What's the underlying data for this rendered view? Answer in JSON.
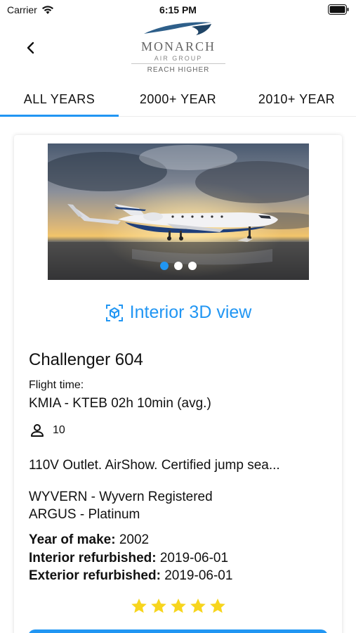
{
  "status_bar": {
    "carrier": "Carrier",
    "time": "6:15 PM",
    "icons": [
      "wifi-icon",
      "battery-icon"
    ]
  },
  "header": {
    "back_icon": "chevron-left-icon",
    "logo": {
      "name": "MONARCH",
      "sub": "AIR GROUP",
      "tagline": "REACH HIGHER"
    }
  },
  "tabs": [
    {
      "label": "ALL YEARS",
      "active": true
    },
    {
      "label": "2000+ YEAR",
      "active": false
    },
    {
      "label": "2010+ YEAR",
      "active": false
    }
  ],
  "listing": {
    "carousel": {
      "total": 3,
      "current": 1
    },
    "interior_view": {
      "label": "Interior 3D view",
      "icon": "cube-icon"
    },
    "model": "Challenger 604",
    "flight_time_label": "Flight time:",
    "flight_time_value": "KMIA - KTEB 02h 10min (avg.)",
    "passengers": "10",
    "amenities": "110V Outlet. AirShow. Certified jump sea...",
    "certifications": [
      "WYVERN - Wyvern Registered",
      "ARGUS - Platinum"
    ],
    "specs": [
      {
        "label": "Year of make:",
        "value": "2002"
      },
      {
        "label": "Interior refurbished:",
        "value": "2019-06-01"
      },
      {
        "label": "Exterior refurbished:",
        "value": "2019-06-01"
      }
    ],
    "rating": 5
  },
  "colors": {
    "accent": "#2196f3",
    "star": "#f7d51d"
  }
}
